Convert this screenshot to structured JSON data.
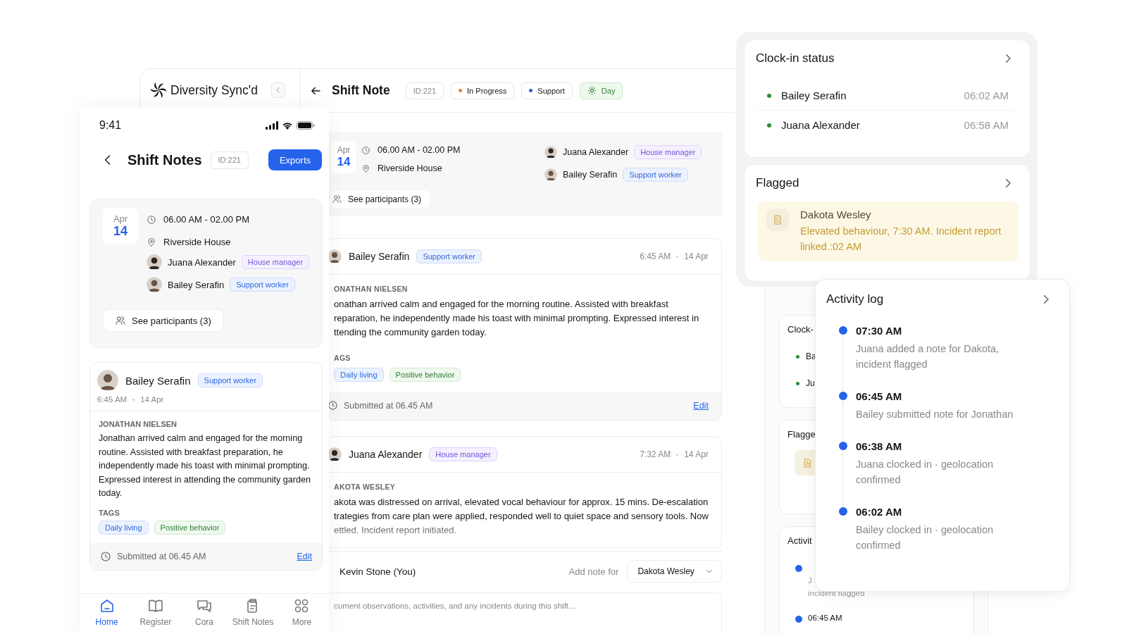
{
  "desktop": {
    "brand": "Diversity Sync'd",
    "title": "Shift Note",
    "id_chip": "ID:221",
    "chips": [
      {
        "label": "In Progress",
        "kind": "status",
        "color": "#e0843a"
      },
      {
        "label": "Support",
        "kind": "status",
        "color": "#2f5fe0"
      },
      {
        "label": "Day",
        "kind": "day"
      }
    ],
    "shift": {
      "month": "Apr",
      "day": "14",
      "time": "06.00 AM - 02.00 PM",
      "location": "Riverside House",
      "staff": [
        {
          "name": "Juana Alexander",
          "role": "House manager",
          "kind": "manager"
        },
        {
          "name": "Bailey Serafin",
          "role": "Support worker",
          "kind": "support"
        }
      ],
      "participants_button": "See participants (3)"
    },
    "notes": [
      {
        "author": "Bailey Serafin",
        "role": {
          "label": "Support worker",
          "kind": "support"
        },
        "time": "6:45 AM",
        "date": "14 Apr",
        "subject": "ONATHAN NIELSEN",
        "body": "onathan arrived calm and engaged for the morning routine. Assisted with breakfast\nreparation, he independently made his toast with minimal prompting. Expressed interest in\nttending the community garden today.",
        "tags_label": "AGS",
        "tags": [
          {
            "label": "Daily living",
            "kind": "daily"
          },
          {
            "label": "Positive behavior",
            "kind": "positive"
          }
        ],
        "submitted": "Submitted at 06.45 AM",
        "edit": "Edit"
      },
      {
        "author": "Juana Alexander",
        "role": {
          "label": "House manager",
          "kind": "manager"
        },
        "time": "7:32 AM",
        "date": "14 Apr",
        "subject": "AKOTA WESLEY",
        "body": "akota was distressed on arrival, elevated vocal behaviour for approx. 15 mins. De-escalation\ntrategies from care plan were applied, responded well to quiet space and sensory tools. Now\nettled. Incident report initiated."
      }
    ],
    "composer": {
      "author": "Kevin Stone (You)",
      "add_label": "Add note for",
      "recipient": "Dakota Wesley",
      "placeholder": "cument observations, activities, and any incidents during this shift..."
    }
  },
  "phone": {
    "status_time": "9:41",
    "title": "Shift Notes",
    "id_chip": "ID:221",
    "export_button": "Exports",
    "shift": {
      "month": "Apr",
      "day": "14",
      "time": "06.00 AM - 02.00 PM",
      "location": "Riverside House",
      "staff": [
        {
          "name": "Juana Alexander",
          "role": "House manager",
          "kind": "manager"
        },
        {
          "name": "Bailey Serafin",
          "role": "Support worker",
          "kind": "support"
        }
      ],
      "participants_button": "See participants (3)"
    },
    "note": {
      "author": "Bailey Serafin",
      "role": {
        "label": "Support worker",
        "kind": "support"
      },
      "time": "6:45 AM",
      "date": "14 Apr",
      "subject": "JONATHAN NIELSEN",
      "body": "Jonathan arrived calm and engaged for the morning routine. Assisted with breakfast preparation, he independently made his toast with minimal prompting. Expressed interest in attending the community garden today.",
      "tags_label": "TAGS",
      "tags": [
        {
          "label": "Daily living",
          "kind": "daily"
        },
        {
          "label": "Positive behavior",
          "kind": "positive"
        }
      ],
      "submitted": "Submitted at 06.45 AM",
      "edit": "Edit"
    },
    "nav": [
      {
        "label": "Home",
        "selected": true
      },
      {
        "label": "Register",
        "selected": false
      },
      {
        "label": "Cora",
        "selected": false
      },
      {
        "label": "Shift Notes",
        "selected": false
      },
      {
        "label": "More",
        "selected": false
      }
    ]
  },
  "clock_in": {
    "title": "Clock-in status",
    "rows": [
      {
        "name": "Bailey Serafin",
        "time": "06:02 AM"
      },
      {
        "name": "Juana Alexander",
        "time": "06:58 AM"
      }
    ]
  },
  "flagged": {
    "title": "Flagged",
    "items": [
      {
        "name": "Dakota Wesley",
        "text": "Elevated behaviour, 7:30 AM. Incident report linked.:02 AM"
      }
    ]
  },
  "background_panel": {
    "clock_title": "Clock-",
    "clock_rows": [
      "Ba",
      "Ju"
    ],
    "flagged_title": "Flagge",
    "activity_title": "Activit",
    "activity_items": [
      {
        "lines": [
          "J",
          "incident flagged"
        ]
      },
      {
        "time": "06:45 AM"
      }
    ]
  },
  "activity_log": {
    "title": "Activity log",
    "items": [
      {
        "time": "07:30 AM",
        "text": "Juana added a note for Dakota, incident flagged"
      },
      {
        "time": "06:45 AM",
        "text": "Bailey submitted note for Jonathan"
      },
      {
        "time": "06:38 AM",
        "text": "Juana clocked in · geolocation confirmed"
      },
      {
        "time": "06:02 AM",
        "text": "Bailey clocked in · geolocation confirmed"
      }
    ]
  }
}
